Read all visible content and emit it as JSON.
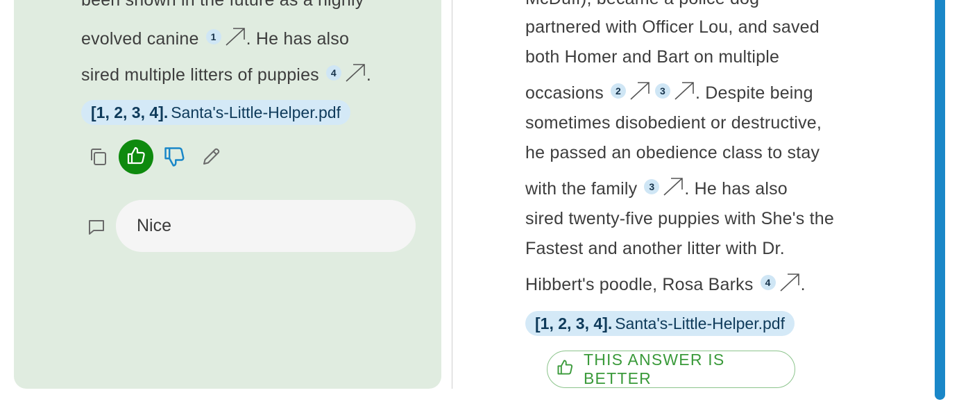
{
  "left": {
    "lines": {
      "l0": "been shown in the future as a highly",
      "l1a": "evolved canine",
      "l1b": ". He has also",
      "l2a": "sired multiple litters of puppies",
      "l2b": "."
    },
    "citations": {
      "c1": "1",
      "c4": "4"
    },
    "source": {
      "refs": "[1, 2, 3, 4].",
      "file": "Santa's-Little-Helper.pdf"
    },
    "actions": {
      "copy": "copy-icon",
      "like": "thumbs-up-icon",
      "dislike": "thumbs-down-icon",
      "edit": "pencil-icon"
    },
    "comment": {
      "value": "Nice"
    }
  },
  "right": {
    "lines": {
      "l0": "McDuff), became a police dog",
      "l1": "partnered with Officer Lou, and saved",
      "l2": "both Homer and Bart on multiple",
      "l3a": "occasions",
      "l3b": ". Despite being",
      "l4": "sometimes disobedient or destructive,",
      "l5": "he passed an obedience class to stay",
      "l6a": "with the family",
      "l6b": ". He has also",
      "l7": "sired twenty-five puppies with She's the",
      "l8": "Fastest and another litter with Dr.",
      "l9a": "Hibbert's poodle, Rosa Barks",
      "l9b": "."
    },
    "citations": {
      "c2": "2",
      "c3a": "3",
      "c3b": "3",
      "c4": "4"
    },
    "source": {
      "refs": "[1, 2, 3, 4].",
      "file": "Santa's-Little-Helper.pdf"
    },
    "better_button": "THIS ANSWER IS BETTER"
  },
  "colors": {
    "left_bg": "#e0ece0",
    "accent_green": "#0e8a0e",
    "citation_bg": "#cfe6f5",
    "scrollbar": "#1a87c8"
  }
}
